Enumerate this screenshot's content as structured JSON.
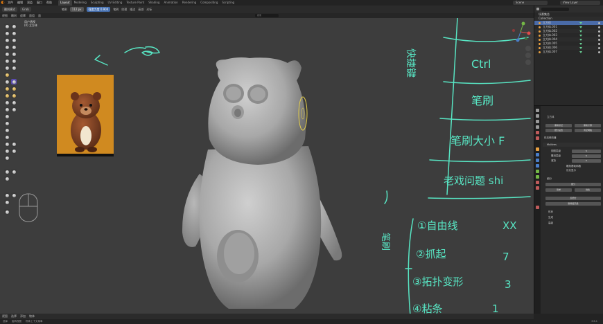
{
  "topbar": {
    "menus": [
      "文件",
      "编辑",
      "渲染",
      "窗口",
      "帮助"
    ],
    "workspaces": [
      "Layout",
      "Modeling",
      "Sculpting",
      "UV Editing",
      "Texture Paint",
      "Shading",
      "Animation",
      "Rendering",
      "Compositing",
      "Scripting"
    ],
    "active_workspace": "Layout",
    "scene": "Scene",
    "view_layer": "View Layer"
  },
  "header": {
    "mode": "雕刻模式",
    "tool": "Grab",
    "brush_label": "笔刷",
    "radius_value": "112 px",
    "strength_value": "强度力度 0.904",
    "menus": [
      "笔刷",
      "纹理",
      "描边",
      "衰减",
      "光标"
    ]
  },
  "header2": {
    "menus": [
      "视图",
      "雕刻",
      "遮罩",
      "面组",
      "面"
    ],
    "search_placeholder": "搜索"
  },
  "viewport": {
    "info_line1": "用户透视",
    "info_line2": "(0) 立方体"
  },
  "annotations": {
    "cht_title": "快捷键",
    "row1": "Ctrl",
    "row2": "笔刷",
    "row3": "笔刷大小 F",
    "row4": "老戏问题 shi",
    "list_label": "笔刷",
    "list1": "①自由线",
    "list1_key": "XX",
    "list2": "②抓起",
    "list2_key": "7",
    "list3": "③拓扑变形",
    "list3_key": "3",
    "list4": "④粘条",
    "list4_key": "1"
  },
  "outliner": {
    "title": "场景集合",
    "collection": "Collection",
    "items": [
      {
        "name": "立方体",
        "selected": true
      },
      {
        "name": "立方体.001",
        "selected": false
      },
      {
        "name": "立方体.002",
        "selected": false
      },
      {
        "name": "立方体.003",
        "selected": false
      },
      {
        "name": "立方体.004",
        "selected": false
      },
      {
        "name": "立方体.005",
        "selected": false
      },
      {
        "name": "立方体.006",
        "selected": false
      },
      {
        "name": "立方体.007",
        "selected": false
      }
    ]
  },
  "properties": {
    "object_name": "立方体",
    "add_modifier": "添加修改器",
    "btn_a": "重新标记",
    "btn_b": "重新计算",
    "btn_c": "细分设置",
    "btn_d": "清空网格",
    "section1": "形态修改器",
    "modifier_name": "Multires",
    "label_viewport": "视图层级",
    "value_viewport": "5",
    "label_sculpt": "雕刻层级",
    "value_sculpt": "5",
    "label_render": "渲染",
    "value_render": "5",
    "check1": "雕刻基础网格",
    "check2": "优化显示",
    "subdivide_header": "细分",
    "btn_subdivide": "细分",
    "btn_simple": "简单",
    "btn_linear": "线性",
    "btn_unsubdivide": "反细分",
    "btn_delete_higher": "删除更高级",
    "section_shape": "形状",
    "section_generate": "生成",
    "section_advanced": "高级"
  },
  "statusbar": {
    "menus": [
      "视图",
      "选择",
      "添加",
      "物体"
    ],
    "row2_items": [
      "选择",
      "旋转视图",
      "物体上下文菜单"
    ],
    "version": "3.6.1"
  },
  "colors": {
    "accent": "#4772b3",
    "selection": "#4a6ba8",
    "ink": "#58e6c4",
    "ref_background": "#c8841b"
  }
}
